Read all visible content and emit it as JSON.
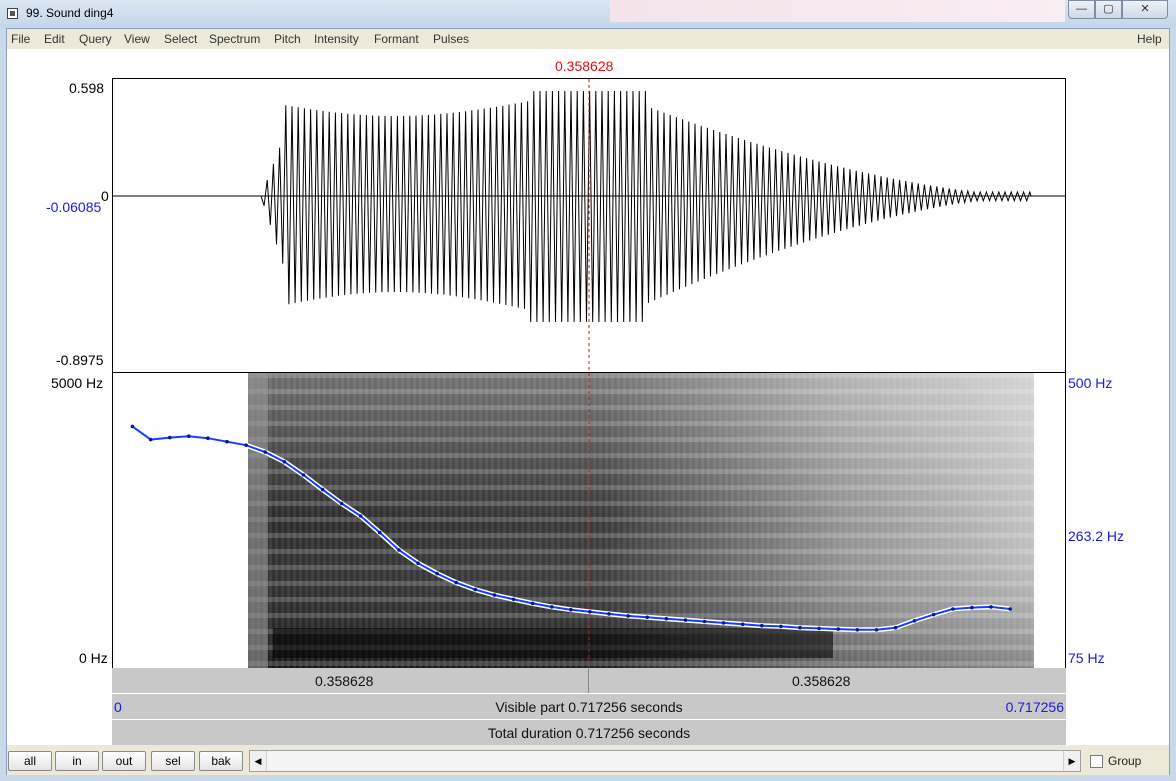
{
  "window": {
    "title": "99. Sound ding4",
    "min_icon": "minimize-icon",
    "max_icon": "maximize-icon",
    "close_icon": "close-icon",
    "min_glyph": "—",
    "max_glyph": "▢",
    "close_glyph": "✕"
  },
  "menu": {
    "items": [
      "File",
      "Edit",
      "Query",
      "View",
      "Select",
      "Spectrum",
      "Pitch",
      "Intensity",
      "Formant",
      "Pulses"
    ],
    "help": "Help"
  },
  "cursor": {
    "time_label": "0.358628",
    "time_s": 0.358628
  },
  "waveform": {
    "y_max": "0.598",
    "y_zero": "0",
    "y_value": "-0.06085",
    "y_min": "-0.8975"
  },
  "spectrogram": {
    "freq_top": "5000 Hz",
    "freq_bottom": "0 Hz",
    "pitch_top": "500 Hz",
    "pitch_mid": "263.2 Hz",
    "pitch_bottom": "75 Hz"
  },
  "chart_data": {
    "type": "line",
    "title": "",
    "xlabel": "",
    "ylabel": "",
    "xlim": [
      0,
      0.717256
    ],
    "ylim": [
      75,
      500
    ],
    "series": [
      {
        "x": [
          0.0146,
          0.0284,
          0.0428,
          0.0571,
          0.0715,
          0.0859,
          0.1003,
          0.1147,
          0.1291,
          0.1435,
          0.1579,
          0.1722,
          0.1866,
          0.201,
          0.2154,
          0.2298,
          0.2442,
          0.2586,
          0.273,
          0.2874,
          0.3018,
          0.3161,
          0.3305,
          0.3449,
          0.3593,
          0.3737,
          0.3881,
          0.4025,
          0.4169,
          0.4313,
          0.4457,
          0.46,
          0.4744,
          0.4888,
          0.5032,
          0.5176,
          0.532,
          0.5464,
          0.5608,
          0.5752,
          0.5896,
          0.6039,
          0.6183,
          0.6327,
          0.6471,
          0.6615,
          0.6759
        ],
        "y": [
          423,
          404,
          407,
          409,
          406,
          401,
          396,
          386,
          372,
          353,
          332,
          312,
          294,
          270,
          245,
          226,
          211,
          198,
          188,
          180,
          174,
          168,
          163,
          159,
          156,
          153,
          150,
          148,
          146,
          144,
          142,
          140,
          138,
          136,
          135,
          133,
          132,
          131,
          130,
          130,
          133,
          143,
          152,
          160,
          162,
          163,
          160
        ]
      }
    ]
  },
  "time_bars": {
    "left_segment": "0.358628",
    "right_segment": "0.358628",
    "visible_start": "0",
    "visible_text": "Visible part 0.717256 seconds",
    "visible_end": "0.717256",
    "total_text": "Total duration 0.717256 seconds"
  },
  "toolbar": {
    "all": "all",
    "in": "in",
    "out": "out",
    "sel": "sel",
    "bak": "bak",
    "group": "Group",
    "group_checked": false,
    "scroll_left_glyph": "◀",
    "scroll_right_glyph": "▶"
  }
}
